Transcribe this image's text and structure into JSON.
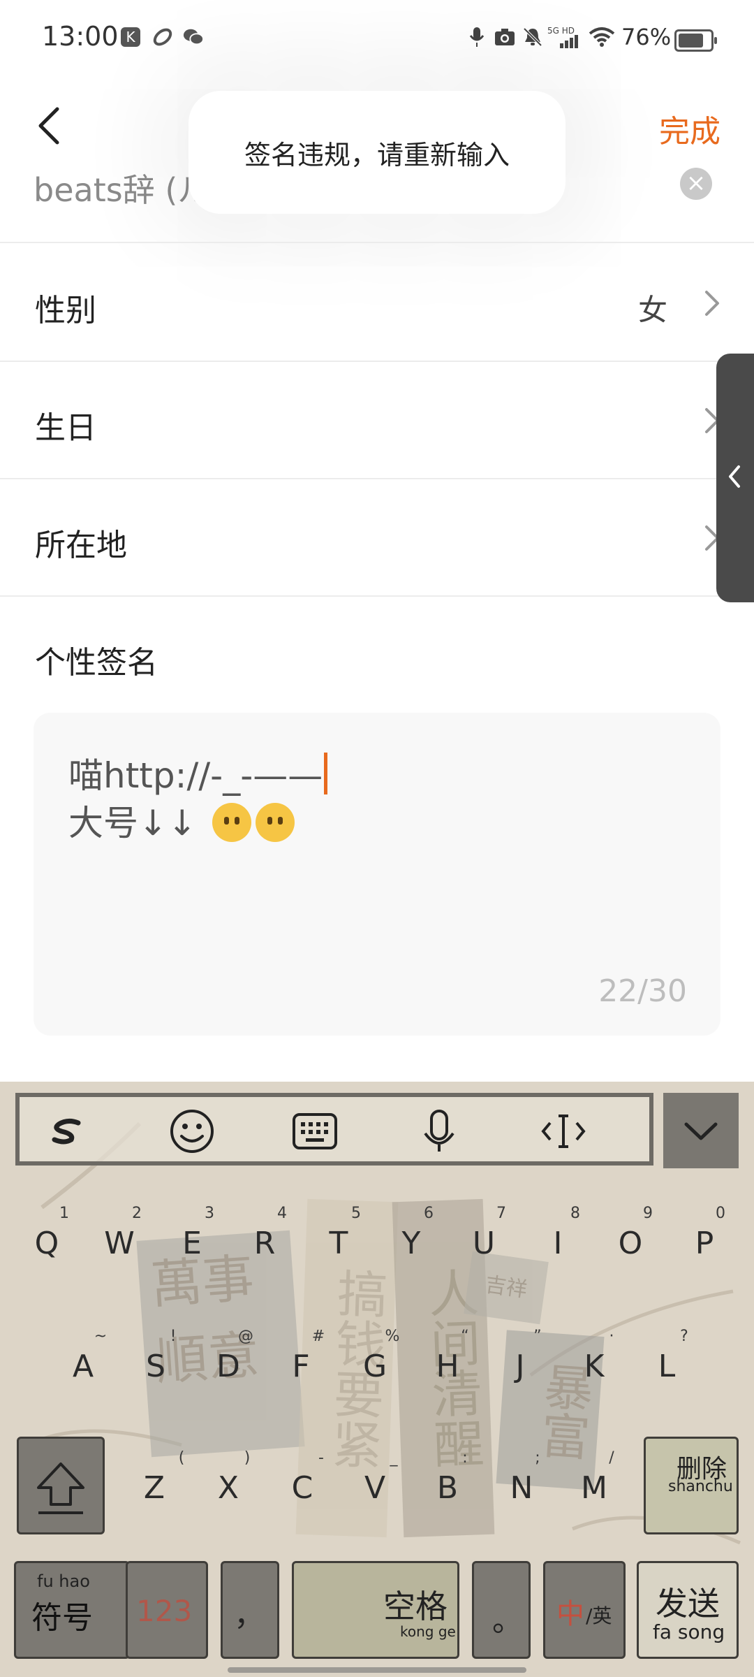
{
  "status_bar": {
    "time": "13:00",
    "left_icons": [
      "k-app-icon",
      "link-app-icon",
      "wechat-icon"
    ],
    "right_icons": [
      "mic-icon",
      "camera-icon",
      "mute-bell-icon",
      "signal-5g-icon",
      "wifi-icon"
    ],
    "network_label": "5G HD",
    "battery": "76%",
    "battery_level": 0.76
  },
  "header": {
    "done_label": "完成",
    "nickname_value": "beats辞 (ル"
  },
  "toast": {
    "message": "签名违规，请重新输入"
  },
  "rows": {
    "gender": {
      "label": "性别",
      "value": "女"
    },
    "birthday": {
      "label": "生日",
      "value": ""
    },
    "location": {
      "label": "所在地",
      "value": ""
    }
  },
  "signature": {
    "section_title": "个性签名",
    "line1": "喵http://-_-——",
    "line2": "大号↓↓",
    "emoji_names": [
      "face-without-mouth",
      "face-without-mouth"
    ],
    "counter": "22/30"
  },
  "keyboard": {
    "toolbar_icons": [
      "sogou-logo-icon",
      "emoji-face-icon",
      "keyboard-icon",
      "microphone-icon",
      "cursor-move-icon",
      "collapse-chevron-icon"
    ],
    "row1": [
      "Q",
      "W",
      "E",
      "R",
      "T",
      "Y",
      "U",
      "I",
      "O",
      "P"
    ],
    "row1_sub": [
      "1",
      "2",
      "3",
      "4",
      "5",
      "6",
      "7",
      "8",
      "9",
      "0"
    ],
    "row2": [
      "A",
      "S",
      "D",
      "F",
      "G",
      "H",
      "J",
      "K",
      "L"
    ],
    "row2_sub": [
      "~",
      "!",
      "@",
      "#",
      "%",
      "“",
      "”",
      "·",
      "?"
    ],
    "row3": [
      "Z",
      "X",
      "C",
      "V",
      "B",
      "N",
      "M"
    ],
    "row3_sub": [
      "(",
      ")",
      "-",
      "_",
      ":",
      ";",
      "/"
    ],
    "delete_label": "删除",
    "delete_pinyin": "shanchu",
    "symbol_pinyin": "fu hao",
    "symbol_label": "符号",
    "num_label": "123",
    "comma_label": "，",
    "space_label": "空格",
    "space_pinyin": "kong ge",
    "period_label": "。",
    "lang_zh": "中",
    "lang_en": "/英",
    "send_label": "发送",
    "send_pinyin": "fa song",
    "deco_text": [
      "萬事",
      "順意",
      "搞钱",
      "要紧",
      "人间",
      "清醒",
      "暴富",
      "吉祥"
    ]
  },
  "colors": {
    "accent": "#e86a1e",
    "keyboard_bg": "#ddd5c7",
    "dark_key": "#7c7973",
    "side_tab": "#4a4a4a"
  }
}
